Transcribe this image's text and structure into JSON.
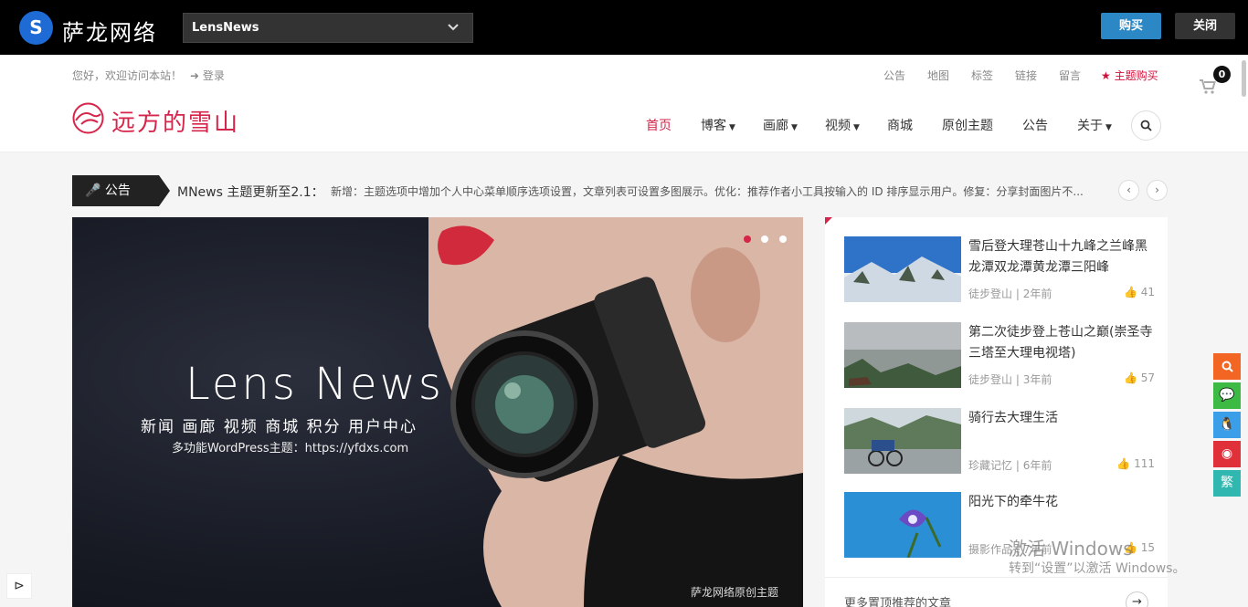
{
  "topbar": {
    "brand_icon": "S",
    "brand_name": "萨龙网络",
    "theme_select": "LensNews",
    "buy": "购买",
    "close": "关闭"
  },
  "header": {
    "welcome": "您好，欢迎访问本站！",
    "login": "登录",
    "links": [
      "公告",
      "地图",
      "标签",
      "链接",
      "留言"
    ],
    "theme_buy": "主题购买",
    "cart_count": "0",
    "logo_text": "远方的雪山",
    "nav": [
      {
        "label": "首页",
        "dropdown": false
      },
      {
        "label": "博客",
        "dropdown": true
      },
      {
        "label": "画廊",
        "dropdown": true
      },
      {
        "label": "视频",
        "dropdown": true
      },
      {
        "label": "商城",
        "dropdown": false
      },
      {
        "label": "原创主题",
        "dropdown": false
      },
      {
        "label": "公告",
        "dropdown": false
      },
      {
        "label": "关于",
        "dropdown": true
      }
    ]
  },
  "notice": {
    "label": "公告",
    "title": "MNews 主题更新至2.1：",
    "text": "新增：主题选项中增加个人中心菜单顺序选项设置，文章列表可设置多图展示。优化：推荐作者小工具按输入的 ID 排序显示用户。修复：分享封面图片不..."
  },
  "slider": {
    "title": "Lens  News",
    "subtitle": "新闻 画廊 视频 商城 积分 用户中心",
    "url_line": "多功能WordPress主题：https://yfdxs.com",
    "caption": "萨龙网络原创主题"
  },
  "sidebar": {
    "posts": [
      {
        "title": "雪后登大理苍山十九峰之兰峰黑龙潭双龙潭黄龙潭三阳峰",
        "category": "徒步登山",
        "time": "2年前",
        "likes": "41"
      },
      {
        "title": "第二次徒步登上苍山之巅(崇圣寺三塔至大理电视塔)",
        "category": "徒步登山",
        "time": "3年前",
        "likes": "57"
      },
      {
        "title": "骑行去大理生活",
        "category": "珍藏记忆",
        "time": "6年前",
        "likes": "111"
      },
      {
        "title": "阳光下的牵牛花",
        "category": "摄影作品",
        "time": "7年前",
        "likes": "15"
      }
    ],
    "more": "更多置顶推荐的文章"
  },
  "float": {
    "trad": "繁"
  },
  "watermark": {
    "line1": "激活 Windows",
    "line2": "转到“设置”以激活 Windows。"
  }
}
